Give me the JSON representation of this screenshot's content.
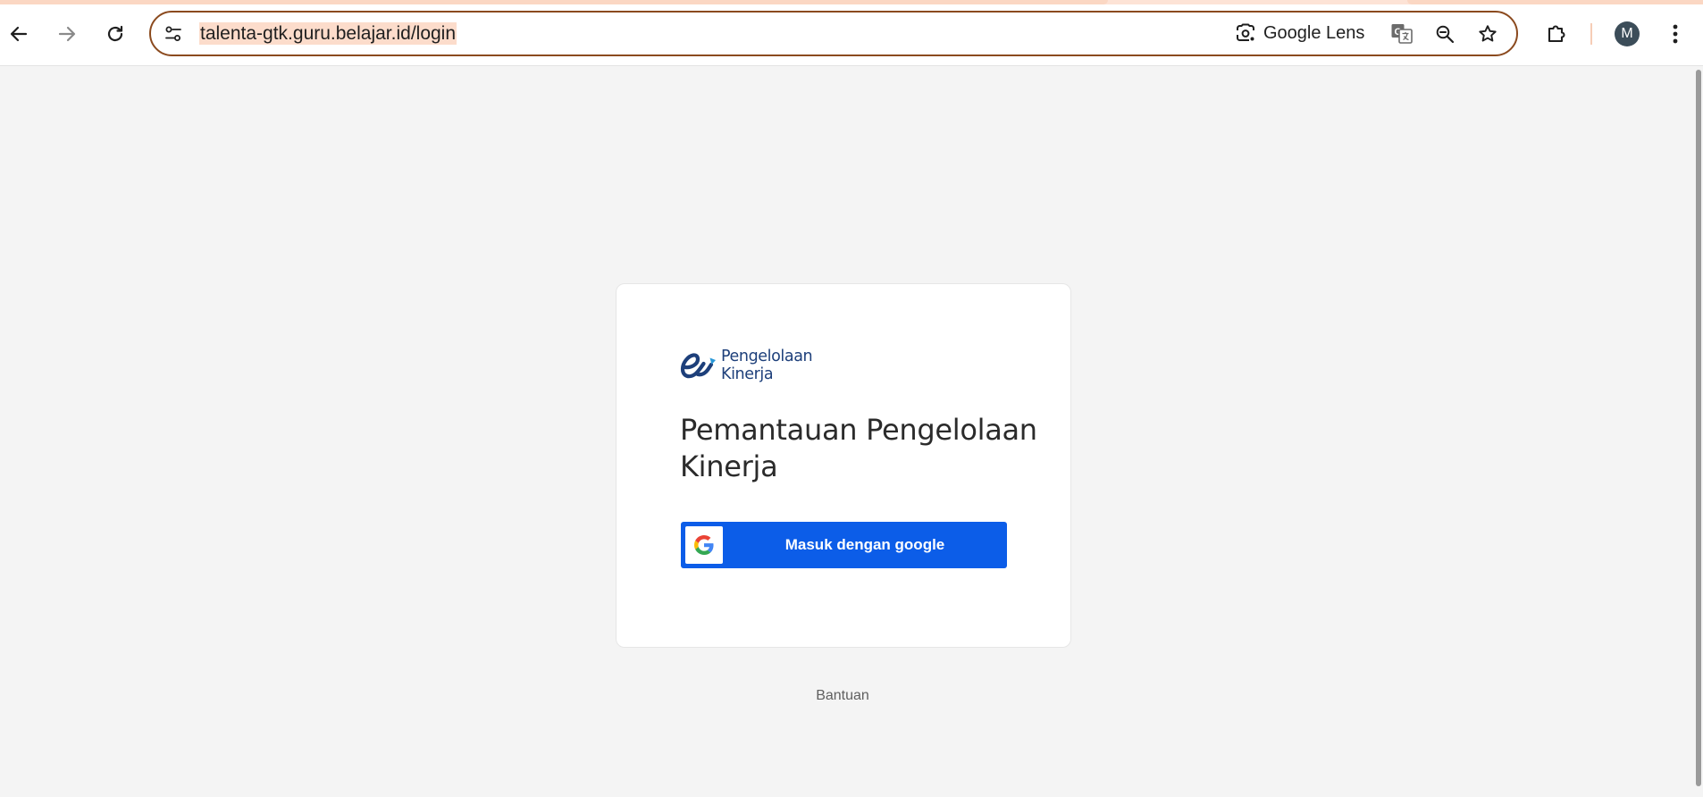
{
  "browser": {
    "url": "talenta-gtk.guru.belajar.id/login",
    "lens_label": "Google Lens",
    "profile_initial": "M",
    "icons": {
      "back": "arrow-left-icon",
      "forward": "arrow-right-icon",
      "reload": "reload-icon",
      "site_info": "tune-icon",
      "lens": "camera-lens-icon",
      "translate": "translate-icon",
      "zoom": "zoom-out-icon",
      "bookmark": "star-icon",
      "extensions": "puzzle-icon",
      "menu": "three-dots-icon"
    },
    "colors": {
      "omnibox_border": "#8b4a1e",
      "url_highlight": "#fcdccb",
      "avatar": "#3c4d59"
    }
  },
  "page": {
    "background": "#f4f4f4",
    "logo": {
      "line1": "Pengelolaan",
      "line2": "Kinerja",
      "color": "#1d3f7a"
    },
    "title": "Pemantauan Pengelolaan Kinerja",
    "login_button": {
      "label": "Masuk dengan google",
      "icon": "google-g-icon",
      "color": "#0c5de8"
    },
    "help_link": "Bantuan"
  }
}
